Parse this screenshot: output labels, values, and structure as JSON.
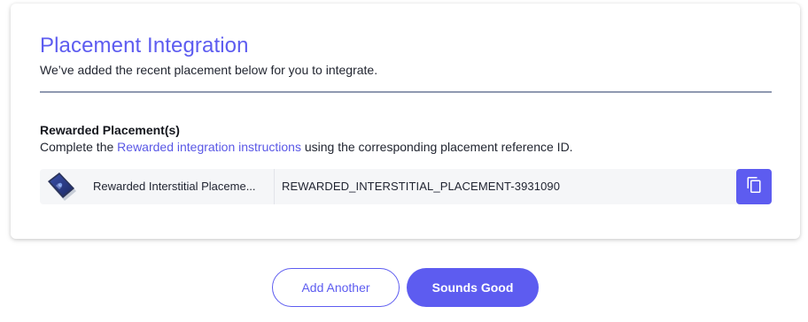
{
  "header": {
    "title": "Placement Integration",
    "subtitle": "We’ve added the recent placement below for you to integrate."
  },
  "section": {
    "title": "Rewarded Placement(s)",
    "desc_before": "Complete the ",
    "desc_link": "Rewarded integration instructions",
    "desc_after": " using the corresponding placement reference ID."
  },
  "placement": {
    "thumbnail_icon": "phone-thumbnail-icon",
    "name": "Rewarded Interstitial Placeme...",
    "reference_id": "REWARDED_INTERSTITIAL_PLACEMENT-3931090",
    "copy_icon": "copy-icon"
  },
  "actions": {
    "add_another_label": "Add Another",
    "sounds_good_label": "Sounds Good"
  },
  "colors": {
    "accent": "#5d5cf0",
    "row_background": "#f5f6f8",
    "divider": "#8f99b0"
  }
}
